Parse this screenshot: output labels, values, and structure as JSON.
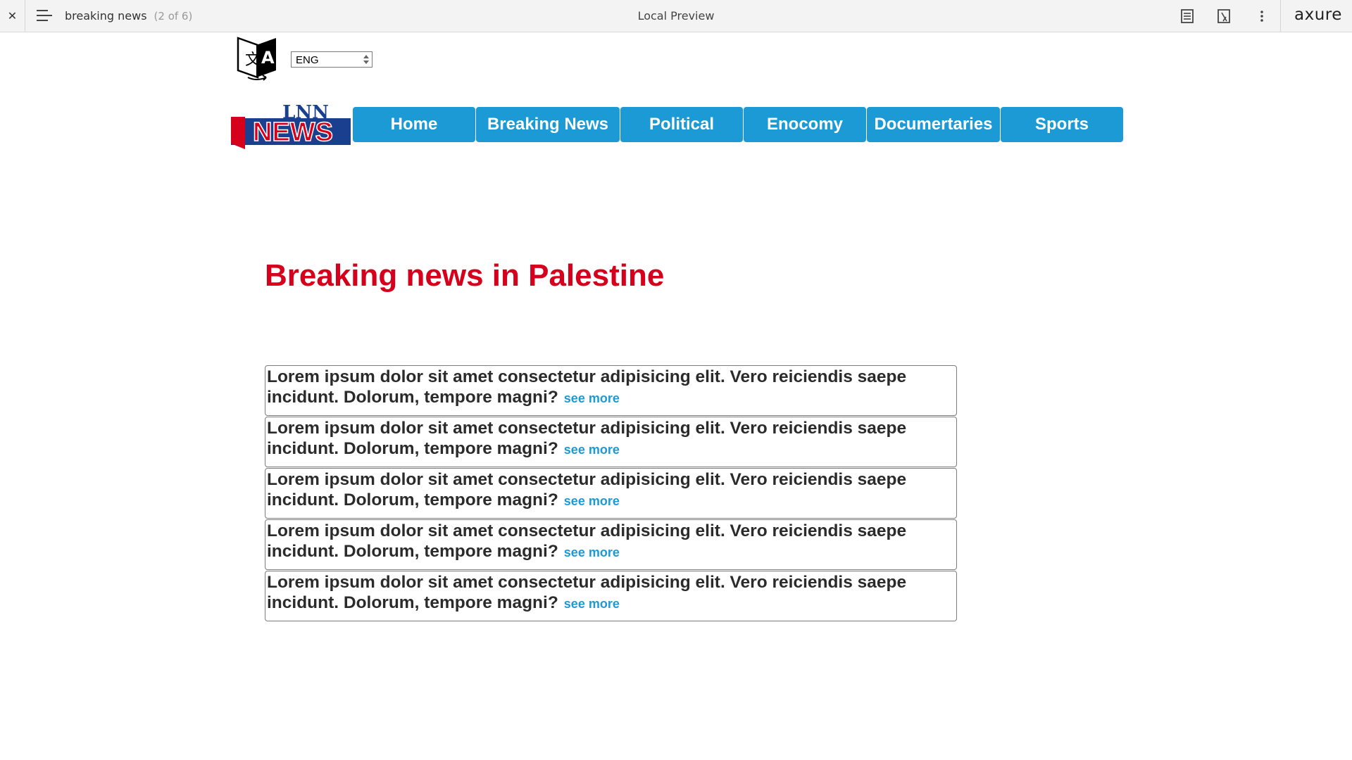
{
  "topbar": {
    "close_icon": "close-icon",
    "menu_icon": "hamburger-menu-icon",
    "page_name": "breaking news",
    "page_count": "(2 of 6)",
    "title": "Local Preview",
    "icons": [
      "page-notes-icon",
      "inspect-icon",
      "more-options-icon"
    ],
    "brand": "axure"
  },
  "language": {
    "icon": "translate-icon",
    "selected": "ENG"
  },
  "logo": {
    "top_text": "LNN",
    "main_text": "NEWS",
    "colors": {
      "blue": "#1b3f8f",
      "red": "#d6001c"
    }
  },
  "nav": {
    "items": [
      {
        "label": "Home"
      },
      {
        "label": "Breaking News"
      },
      {
        "label": "Political"
      },
      {
        "label": "Enocomy"
      },
      {
        "label": "Documertaries"
      },
      {
        "label": "Sports"
      }
    ],
    "color": "#1c9ad6"
  },
  "headline": {
    "text": "Breaking news in Palestine",
    "color": "#d6001c"
  },
  "news": {
    "items": [
      {
        "text": "Lorem ipsum dolor sit amet consectetur adipisicing elit. Vero reiciendis saepe incidunt. Dolorum, tempore magni?",
        "link": "see more"
      },
      {
        "text": "Lorem ipsum dolor sit amet consectetur adipisicing elit. Vero reiciendis saepe incidunt. Dolorum, tempore magni?",
        "link": "see more"
      },
      {
        "text": "Lorem ipsum dolor sit amet consectetur adipisicing elit. Vero reiciendis saepe incidunt. Dolorum, tempore magni?",
        "link": "see more"
      },
      {
        "text": "Lorem ipsum dolor sit amet consectetur adipisicing elit. Vero reiciendis saepe incidunt. Dolorum, tempore magni?",
        "link": "see more"
      },
      {
        "text": "Lorem ipsum dolor sit amet consectetur adipisicing elit. Vero reiciendis saepe incidunt. Dolorum, tempore magni?",
        "link": "see more"
      }
    ]
  }
}
